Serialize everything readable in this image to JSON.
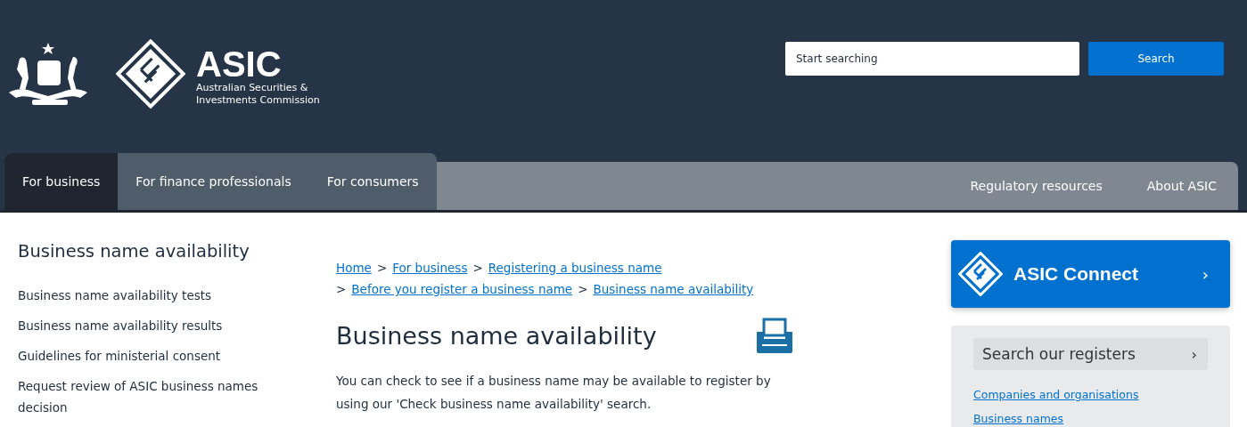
{
  "header": {
    "logo": {
      "name": "ASIC",
      "subtitle_lines": [
        "Australian Securities &",
        "Investments Commission"
      ]
    },
    "search": {
      "placeholder": "Start searching",
      "button": "Search"
    }
  },
  "main_nav": [
    {
      "label": "For business",
      "selected": true
    },
    {
      "label": "For finance professionals",
      "selected": false
    },
    {
      "label": "For consumers",
      "selected": false
    }
  ],
  "secondary_nav": [
    "Regulatory resources",
    "About ASIC"
  ],
  "sidebar": {
    "title": "Business name availability",
    "items": [
      "Business name availability tests",
      "Business name availability results",
      "Guidelines for ministerial consent",
      "Request review of ASIC business names decision"
    ]
  },
  "breadcrumb_lines": [
    [
      "Home",
      "For business",
      "Registering a business name"
    ],
    [
      "Before you register a business name",
      "Business name availability"
    ]
  ],
  "breadcrumb_separator": ">",
  "page_title": "Business name availability",
  "intro": "You can check to see if a business name may be available to register by using our 'Check business name availability' search.",
  "asic_connect": {
    "label": "ASIC Connect",
    "arrow": "›"
  },
  "registers": {
    "title": "Search our registers",
    "arrow": "›",
    "links": [
      "Companies and organisations",
      "Business names"
    ]
  }
}
